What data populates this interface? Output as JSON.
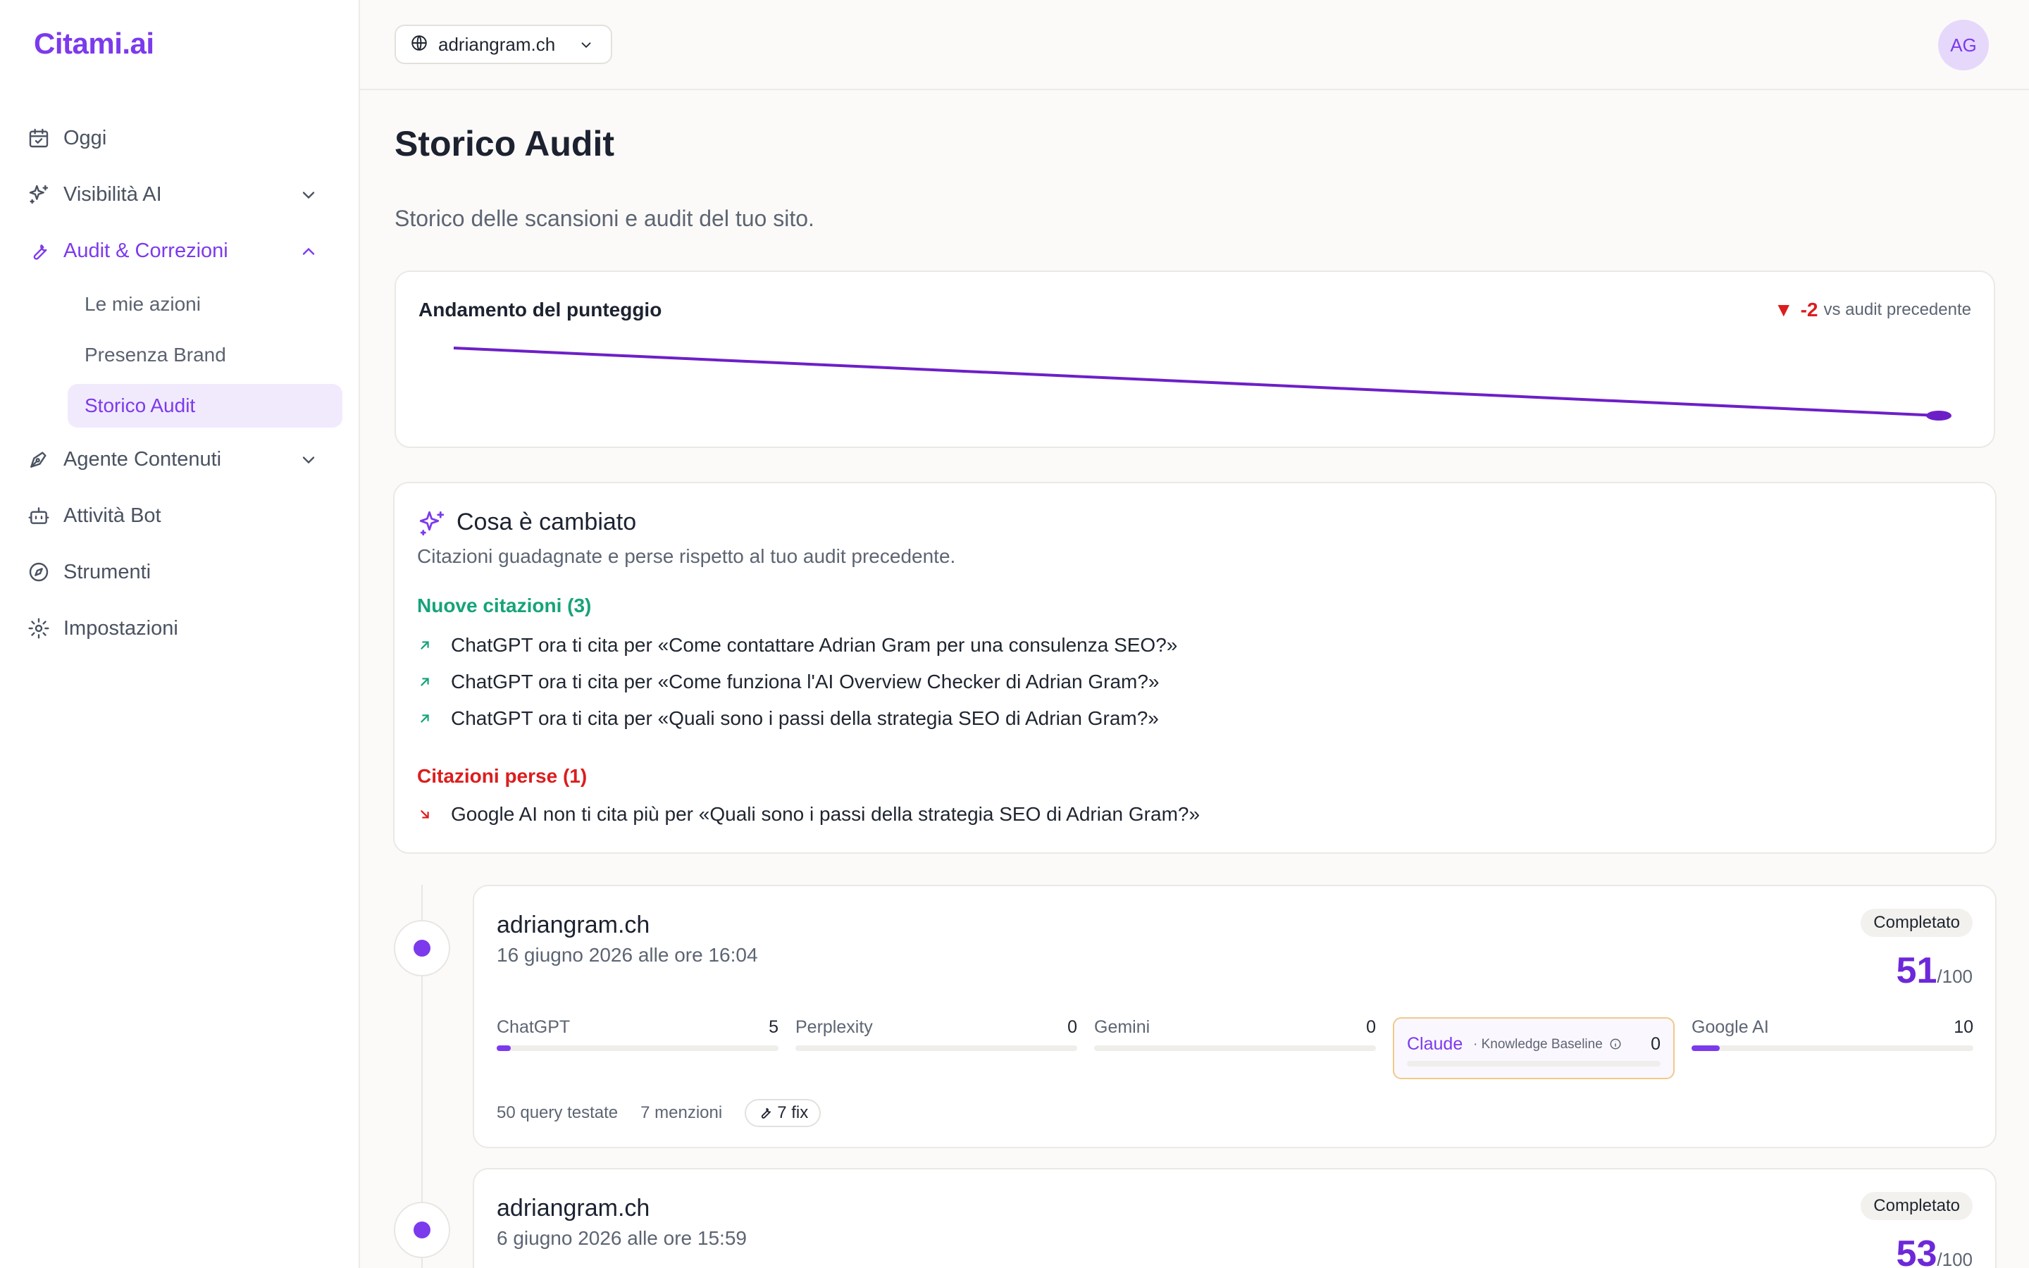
{
  "app": {
    "logo": "Citami.ai"
  },
  "sidebar": {
    "items": [
      {
        "label": "Oggi",
        "icon": "calendar-icon"
      },
      {
        "label": "Visibilità AI",
        "icon": "sparkles-icon"
      },
      {
        "label": "Audit & Correzioni",
        "icon": "wrench-icon"
      },
      {
        "label": "Agente Contenuti",
        "icon": "pen-icon"
      },
      {
        "label": "Attività Bot",
        "icon": "bot-icon"
      },
      {
        "label": "Strumenti",
        "icon": "compass-icon"
      },
      {
        "label": "Impostazioni",
        "icon": "gear-icon"
      }
    ],
    "subitems": [
      "Le mie azioni",
      "Presenza Brand",
      "Storico Audit"
    ]
  },
  "topbar": {
    "domain": "adriangram.ch",
    "avatar": "AG"
  },
  "page": {
    "title": "Storico Audit",
    "subtitle": "Storico delle scansioni e audit del tuo sito."
  },
  "score_chart": {
    "title": "Andamento del punteggio",
    "delta": "-2",
    "delta_label": "vs audit precedente"
  },
  "chart_data": {
    "type": "line",
    "title": "Andamento del punteggio",
    "x": [
      "6 giugno 2026",
      "16 giugno 2026"
    ],
    "series": [
      {
        "values": [
          53,
          51
        ]
      }
    ],
    "xlabel": "",
    "ylabel": ""
  },
  "changes": {
    "title": "Cosa è cambiato",
    "subtitle": "Citazioni guadagnate e perse rispetto al tuo audit precedente.",
    "new_title": "Nuove citazioni (3)",
    "new_items": [
      "ChatGPT ora ti cita per «Come contattare Adrian Gram per una consulenza SEO?»",
      "ChatGPT ora ti cita per «Come funziona l'AI Overview Checker di Adrian Gram?»",
      "ChatGPT ora ti cita per «Quali sono i passi della strategia SEO di Adrian Gram?»"
    ],
    "lost_title": "Citazioni perse (1)",
    "lost_items": [
      "Google AI non ti cita più per «Quali sono i passi della strategia SEO di Adrian Gram?»"
    ]
  },
  "audits": [
    {
      "domain": "adriangram.ch",
      "date": "16 giugno 2026 alle ore 16:04",
      "status": "Completato",
      "score": "51",
      "score_max": "/100",
      "engines": [
        {
          "name": "ChatGPT",
          "value": "5",
          "fill": 0.05
        },
        {
          "name": "Perplexity",
          "value": "0",
          "fill": 0
        },
        {
          "name": "Gemini",
          "value": "0",
          "fill": 0
        },
        {
          "name": "Claude",
          "note": "· Knowledge Baseline",
          "value": "0",
          "fill": 0
        },
        {
          "name": "Google AI",
          "value": "10",
          "fill": 0.1
        }
      ],
      "queries": "50 query testate",
      "mentions": "7 menzioni",
      "fixes": "7 fix"
    },
    {
      "domain": "adriangram.ch",
      "date": "6 giugno 2026 alle ore 15:59",
      "status": "Completato",
      "score": "53",
      "score_max": "/100"
    }
  ],
  "colors": {
    "accent": "#7c3aed",
    "positive": "#16a37a",
    "negative": "#dc1d1d"
  }
}
